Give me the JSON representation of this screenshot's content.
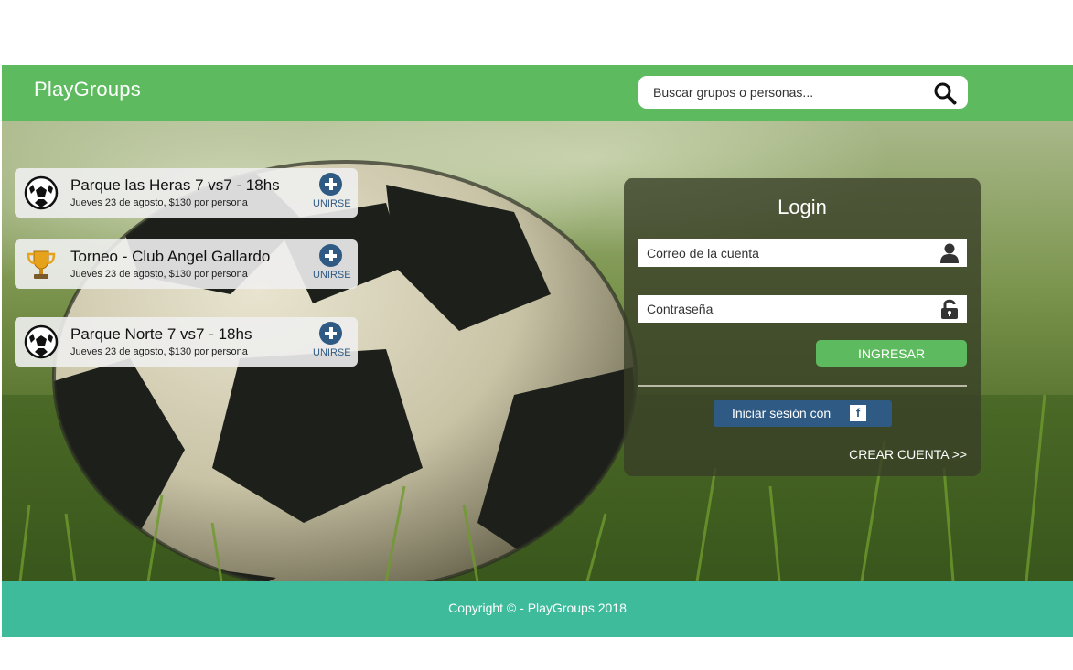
{
  "header": {
    "brand": "PlayGroups",
    "search": {
      "placeholder": "Buscar grupos o personas..."
    }
  },
  "events": [
    {
      "icon": "soccer-ball-icon",
      "title": "Parque las Heras 7 vs7 - 18hs",
      "subtitle": "Jueves 23 de agosto, $130 por persona",
      "action": "UNIRSE"
    },
    {
      "icon": "trophy-icon",
      "title": "Torneo - Club Angel Gallardo",
      "subtitle": "Jueves 23 de agosto, $130 por persona",
      "action": "UNIRSE"
    },
    {
      "icon": "soccer-ball-icon",
      "title": "Parque Norte 7 vs7 - 18hs",
      "subtitle": "Jueves 23 de agosto, $130 por persona",
      "action": "UNIRSE"
    }
  ],
  "login": {
    "title": "Login",
    "email_placeholder": "Correo de la cuenta",
    "password_placeholder": "Contraseña",
    "submit_label": "INGRESAR",
    "facebook_label": "Iniciar sesión con",
    "facebook_icon": "f",
    "create_account": "CREAR CUENTA >>"
  },
  "footer": {
    "copyright": "Copyright © - PlayGroups 2018"
  },
  "colors": {
    "header": "#5dba5e",
    "footer": "#3dbb9b",
    "join_blue": "#2f5a84",
    "login_button": "#5dba5e",
    "facebook_button": "#2f5a84"
  }
}
